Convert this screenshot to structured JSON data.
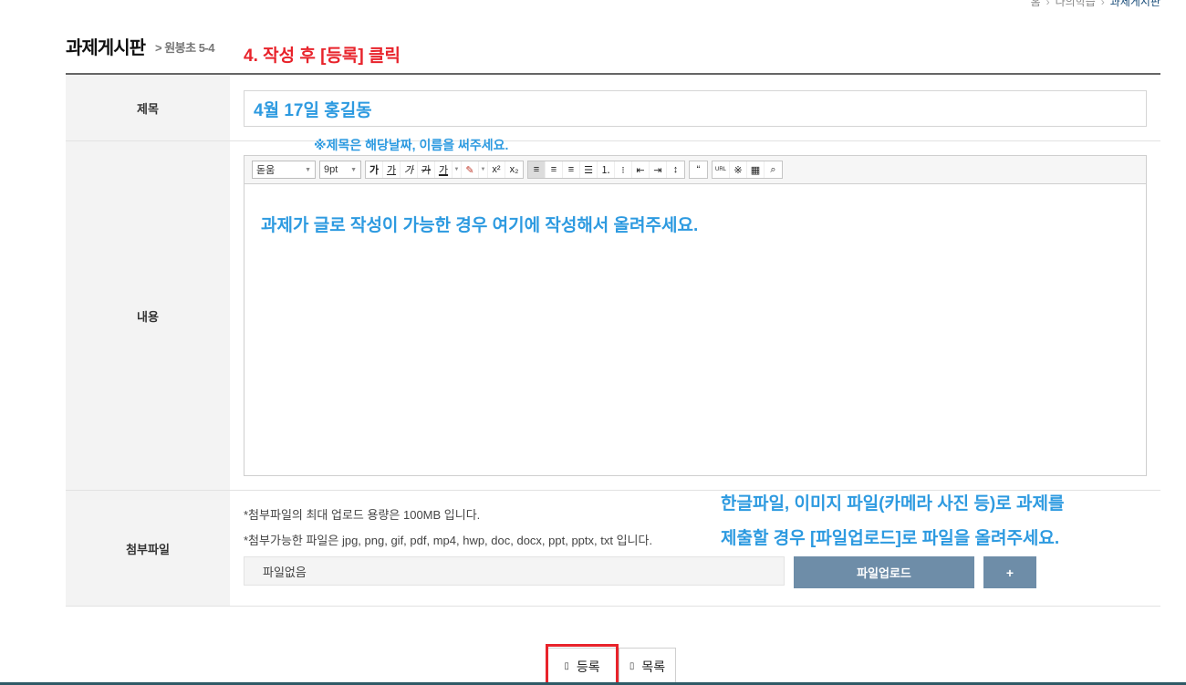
{
  "breadcrumb": {
    "home": "홈",
    "level2": "나의학습",
    "current": "과제게시판",
    "separator": "›"
  },
  "page": {
    "title": "과제게시판",
    "subtitle": "> 원봉초 5-4"
  },
  "annotations": {
    "step": "4. 작성 후 [등록] 클릭",
    "title_hint": "※제목은 해당날짜, 이름을 써주세요.",
    "file_hint_line1": "한글파일, 이미지 파일(카메라 사진 등)로 과제를",
    "file_hint_line2": "제출할 경우 [파일업로드]로 파일을 올려주세요.",
    "colors": {
      "red": "#e8232b",
      "blue": "#2d9ae0"
    }
  },
  "form": {
    "title_label": "제목",
    "title_value": "4월 17일 홍길동",
    "content_label": "내용",
    "content_value": "과제가 글로 작성이 가능한 경우 여기에 작성해서 올려주세요.",
    "attach_label": "첨부파일",
    "attach_note1": "*첨부파일의 최대 업로드 용량은 100MB 입니다.",
    "attach_note2": "*첨부가능한 파일은 jpg, png, gif, pdf, mp4, hwp, doc, docx, ppt, pptx, txt 입니다.",
    "file_status": "파일없음",
    "upload_label": "파일업로드",
    "add_label": "+"
  },
  "editor_toolbar": {
    "font_family": "돋움",
    "font_size": "9pt",
    "format_buttons": [
      "가",
      "가",
      "가",
      "가",
      "가"
    ],
    "icons": [
      "bold-icon",
      "underline-icon",
      "italic-icon",
      "strikethrough-icon",
      "font-color-icon",
      "background-color-icon",
      "superscript-icon",
      "subscript-icon",
      "align-left-icon",
      "align-center-icon",
      "align-right-icon",
      "align-justify-icon",
      "ordered-list-icon",
      "unordered-list-icon",
      "outdent-icon",
      "indent-icon",
      "line-height-icon",
      "quote-icon",
      "link-icon",
      "special-char-icon",
      "table-icon",
      "find-icon"
    ]
  },
  "actions": {
    "submit_label": "등록",
    "list_label": "목록"
  }
}
